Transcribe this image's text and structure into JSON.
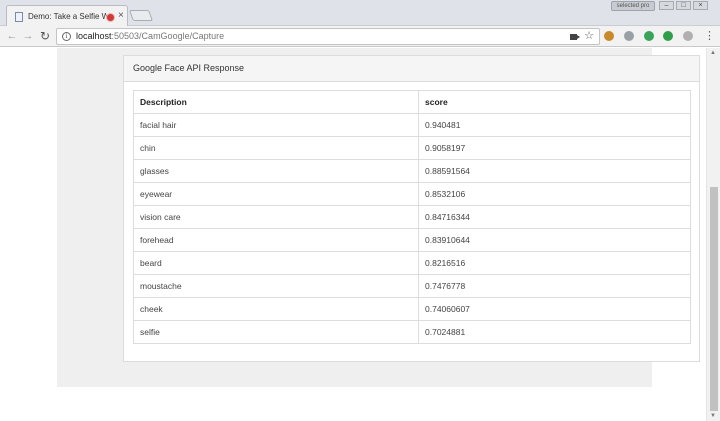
{
  "browser": {
    "tab_title": "Demo: Take a Selfie W",
    "tab_close": "×",
    "profile_label": "selected pro",
    "url_host": "localhost",
    "url_path": ":50503/CamGoogle/Capture",
    "nav": {
      "back": "←",
      "forward": "→",
      "reload": "↻"
    },
    "menu_glyph": "⋮",
    "window_controls": {
      "minimize": "–",
      "maximize": "□",
      "close": "×"
    },
    "extension_colors": [
      "#c98a2c",
      "#9aa0a8",
      "#3aa35a",
      "#2f9e49",
      "#b0b0b0"
    ]
  },
  "panel": {
    "heading": "Google Face API Response"
  },
  "table": {
    "headers": [
      "Description",
      "score"
    ],
    "rows": [
      [
        "facial hair",
        "0.940481"
      ],
      [
        "chin",
        "0.9058197"
      ],
      [
        "glasses",
        "0.88591564"
      ],
      [
        "eyewear",
        "0.8532106"
      ],
      [
        "vision care",
        "0.84716344"
      ],
      [
        "forehead",
        "0.83910644"
      ],
      [
        "beard",
        "0.8216516"
      ],
      [
        "moustache",
        "0.7476778"
      ],
      [
        "cheek",
        "0.74060607"
      ],
      [
        "selfie",
        "0.7024881"
      ]
    ]
  }
}
